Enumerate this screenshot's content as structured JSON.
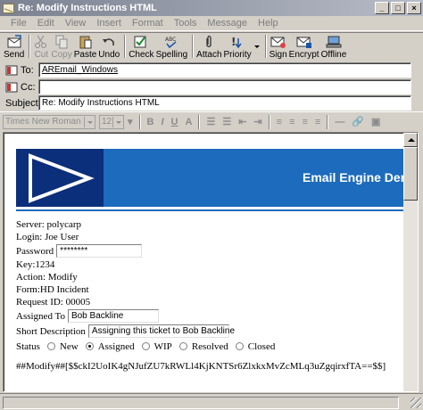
{
  "window": {
    "title": "Re: Modify Instructions HTML"
  },
  "menu": [
    "File",
    "Edit",
    "View",
    "Insert",
    "Format",
    "Tools",
    "Message",
    "Help"
  ],
  "toolbar": {
    "send": "Send",
    "cut": "Cut",
    "copy": "Copy",
    "paste": "Paste",
    "undo": "Undo",
    "check": "Check",
    "spelling": "Spelling",
    "attach": "Attach",
    "priority": "Priority",
    "sign": "Sign",
    "encrypt": "Encrypt",
    "offline": "Offline"
  },
  "header": {
    "to_label": "To:",
    "to_value": "AREmail_Windows",
    "cc_label": "Cc:",
    "cc_value": "",
    "subject_label": "Subject:",
    "subject_value": "Re: Modify Instructions HTML"
  },
  "format": {
    "font": "Times New Roman",
    "size": "12"
  },
  "message": {
    "banner_title": "Email Engine Den",
    "server": "Server: polycarp",
    "login": "Login: Joe User",
    "password_label": "Password",
    "password_value": "********",
    "key": "Key:1234",
    "action": "Action: Modify",
    "form": "Form:HD Incident",
    "request_id": "Request ID: 00005",
    "assigned_to_label": "Assigned To",
    "assigned_to_value": "Bob Backline",
    "short_desc_label": "Short Description",
    "short_desc_value": "Assigning this ticket to Bob Backline",
    "status_label": "Status",
    "status_options": [
      "New",
      "Assigned",
      "WIP",
      "Resolved",
      "Closed"
    ],
    "status_selected": "Assigned",
    "token": "##Modify##[$$ckI2UoIK4gNJufZU7kRWLl4KjKNTSr6ZlxkxMvZcMLq3uZgqirxfTA==$$]"
  },
  "colors": {
    "banner_blue": "#1d6bbd",
    "banner_dark": "#0b2f7a",
    "title_bar": "#7b8190"
  }
}
